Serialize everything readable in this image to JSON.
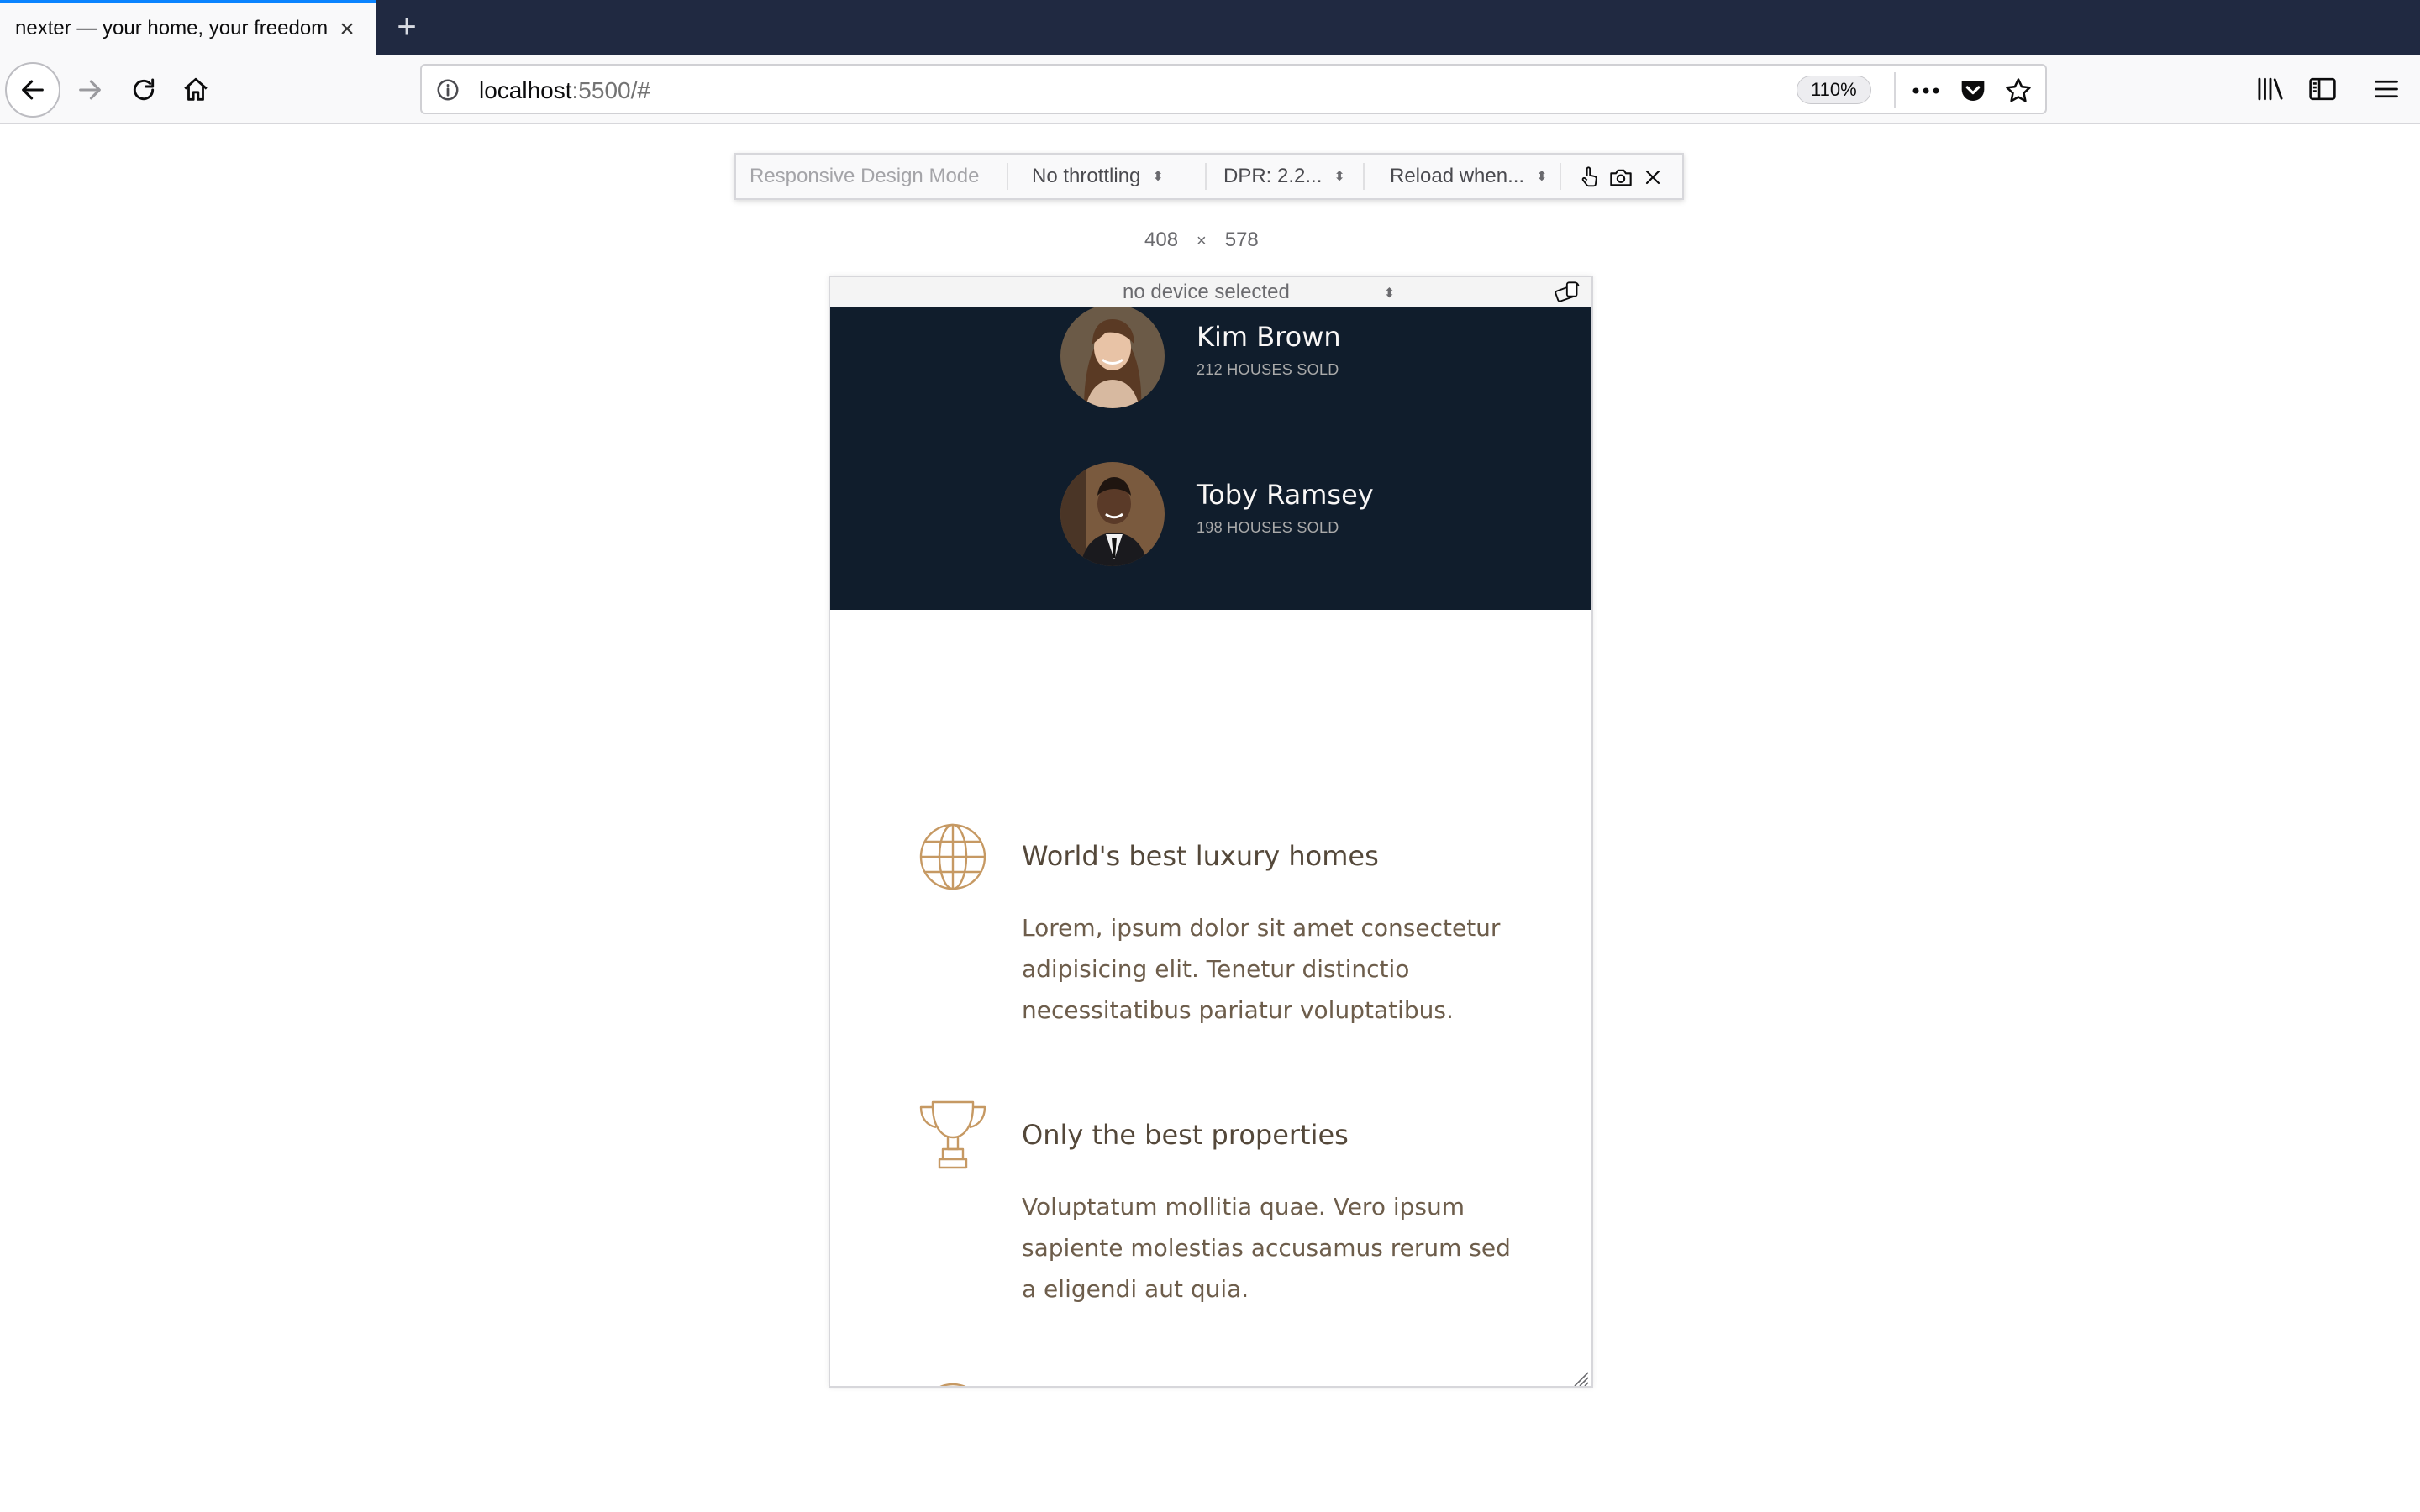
{
  "browser": {
    "tab_title": "nexter — your home, your freedom",
    "url_host": "localhost",
    "url_rest": ":5500/#",
    "zoom": "110%"
  },
  "rdm": {
    "label": "Responsive Design Mode",
    "throttling": "No throttling",
    "dpr": "DPR: 2.2...",
    "reload": "Reload when...",
    "width": "408",
    "times": "×",
    "height": "578",
    "device": "no device selected"
  },
  "realtors": [
    {
      "name": "Kim Brown",
      "sold": "212 HOUSES SOLD"
    },
    {
      "name": "Toby Ramsey",
      "sold": "198 HOUSES SOLD"
    }
  ],
  "features": [
    {
      "icon": "globe-icon",
      "title": "World's best luxury homes",
      "text": "Lorem, ipsum dolor sit amet consectetur adipisicing elit. Tenetur distinctio necessitatibus pariatur voluptatibus."
    },
    {
      "icon": "trophy-icon",
      "title": "Only the best properties",
      "text": "Voluptatum mollitia quae. Vero ipsum sapiente molestias accusamus rerum sed a eligendi aut quia."
    }
  ],
  "colors": {
    "chrome_dark": "#202941",
    "tab_accent": "#0a84ff",
    "realtors_bg": "#101d2c",
    "feature_icon": "#c69963",
    "feature_title": "#54483a",
    "feature_text": "#6d5d4b"
  }
}
